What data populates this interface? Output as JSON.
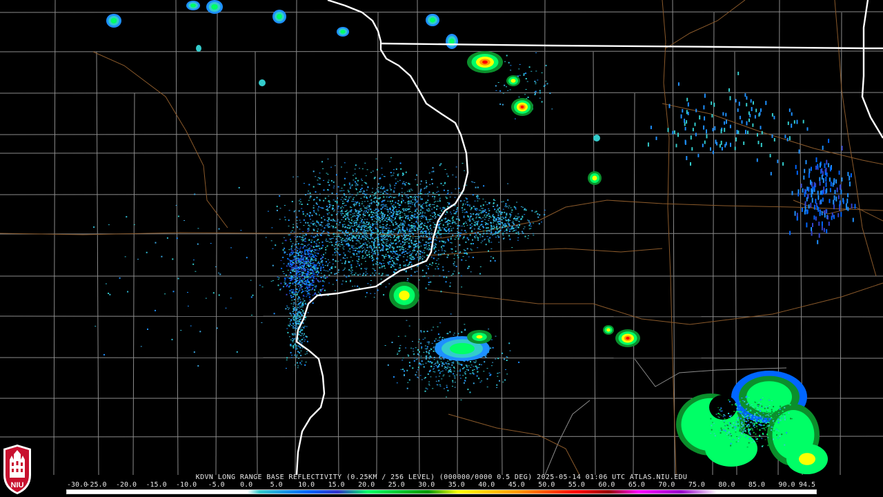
{
  "caption": "KDVN LONG RANGE BASE REFLECTIVITY (0.25KM / 256 LEVEL) (000000/0000 0.5 DEG) 2025-05-14 01:06 UTC  ATLAS.NIU.EDU",
  "logo": {
    "text": "NIU",
    "color": "#c8102e"
  },
  "colors": {
    "background": "#000000",
    "county_lines": "#8c8c8c",
    "state_lines": "#ffffff",
    "roads": "#8b5a2b"
  },
  "scale": {
    "labels": [
      "-30.0",
      "-25.0",
      "-20.0",
      "-15.0",
      "-10.0",
      "-5.0",
      "0.0",
      "5.0",
      "10.0",
      "15.0",
      "20.0",
      "25.0",
      "30.0",
      "35.0",
      "40.0",
      "45.0",
      "50.0",
      "55.0",
      "60.0",
      "65.0",
      "70.0",
      "75.0",
      "80.0",
      "85.0",
      "90.0",
      "94.5"
    ],
    "stops": [
      {
        "dbz": -30,
        "color": "#ffffff"
      },
      {
        "dbz": 0,
        "color": "#ffffff"
      },
      {
        "dbz": 2,
        "color": "#33cccc"
      },
      {
        "dbz": 10,
        "color": "#0066ff"
      },
      {
        "dbz": 15,
        "color": "#3333cc"
      },
      {
        "dbz": 20,
        "color": "#00ff66"
      },
      {
        "dbz": 30,
        "color": "#009900"
      },
      {
        "dbz": 35,
        "color": "#ffff00"
      },
      {
        "dbz": 45,
        "color": "#ff9900"
      },
      {
        "dbz": 55,
        "color": "#ff0000"
      },
      {
        "dbz": 60,
        "color": "#990000"
      },
      {
        "dbz": 65,
        "color": "#ff00ff"
      },
      {
        "dbz": 72,
        "color": "#9900cc"
      },
      {
        "dbz": 78,
        "color": "#ffffff"
      },
      {
        "dbz": 94.5,
        "color": "#ffffff"
      }
    ]
  }
}
